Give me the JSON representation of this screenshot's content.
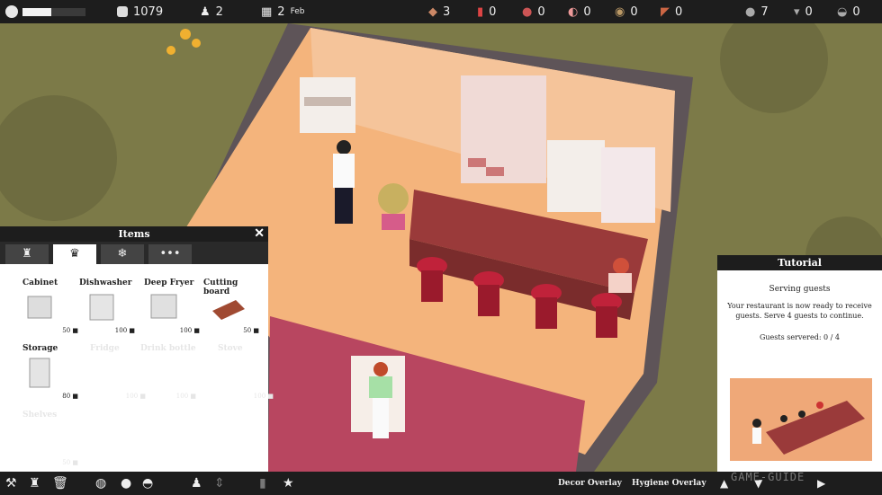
{
  "topbar": {
    "happiness_fill": 0.45,
    "money": "1079",
    "staff": "2",
    "day": "2",
    "month": "Feb",
    "ingredients": [
      "3",
      "0",
      "0",
      "0",
      "0",
      "0"
    ],
    "dishes": [
      "7",
      "0",
      "0"
    ]
  },
  "items_panel": {
    "title": "Items",
    "close": "✕",
    "tabs": [
      {
        "icon": "chair-icon",
        "glyph": "♜"
      },
      {
        "icon": "chef-hat-icon",
        "glyph": "♛"
      },
      {
        "icon": "snowflake-icon",
        "glyph": "❄"
      },
      {
        "icon": "more-icon",
        "glyph": "•••"
      }
    ],
    "items": [
      {
        "name": "Cabinet",
        "price": "50"
      },
      {
        "name": "Dishwasher",
        "price": "100"
      },
      {
        "name": "Deep Fryer",
        "price": "100"
      },
      {
        "name": "Cutting board",
        "price": "50"
      },
      {
        "name": "Storage",
        "price": "80"
      },
      {
        "name": "Fridge",
        "price": "100"
      },
      {
        "name": "Drink bottle",
        "price": "100"
      },
      {
        "name": "Stove",
        "price": "100"
      },
      {
        "name": "Shelves",
        "price": "50"
      }
    ]
  },
  "tutorial": {
    "title": "Tutorial",
    "heading": "Serving guests",
    "body": "Your restaurant is now ready to receive guests. Serve 4 guests to continue.",
    "progress": "Guests servered: 0 / 4"
  },
  "bottombar": {
    "decor_overlay": "Decor Overlay",
    "hygiene_overlay": "Hygiene Overlay",
    "watermark": "GAME-GUIDE"
  }
}
